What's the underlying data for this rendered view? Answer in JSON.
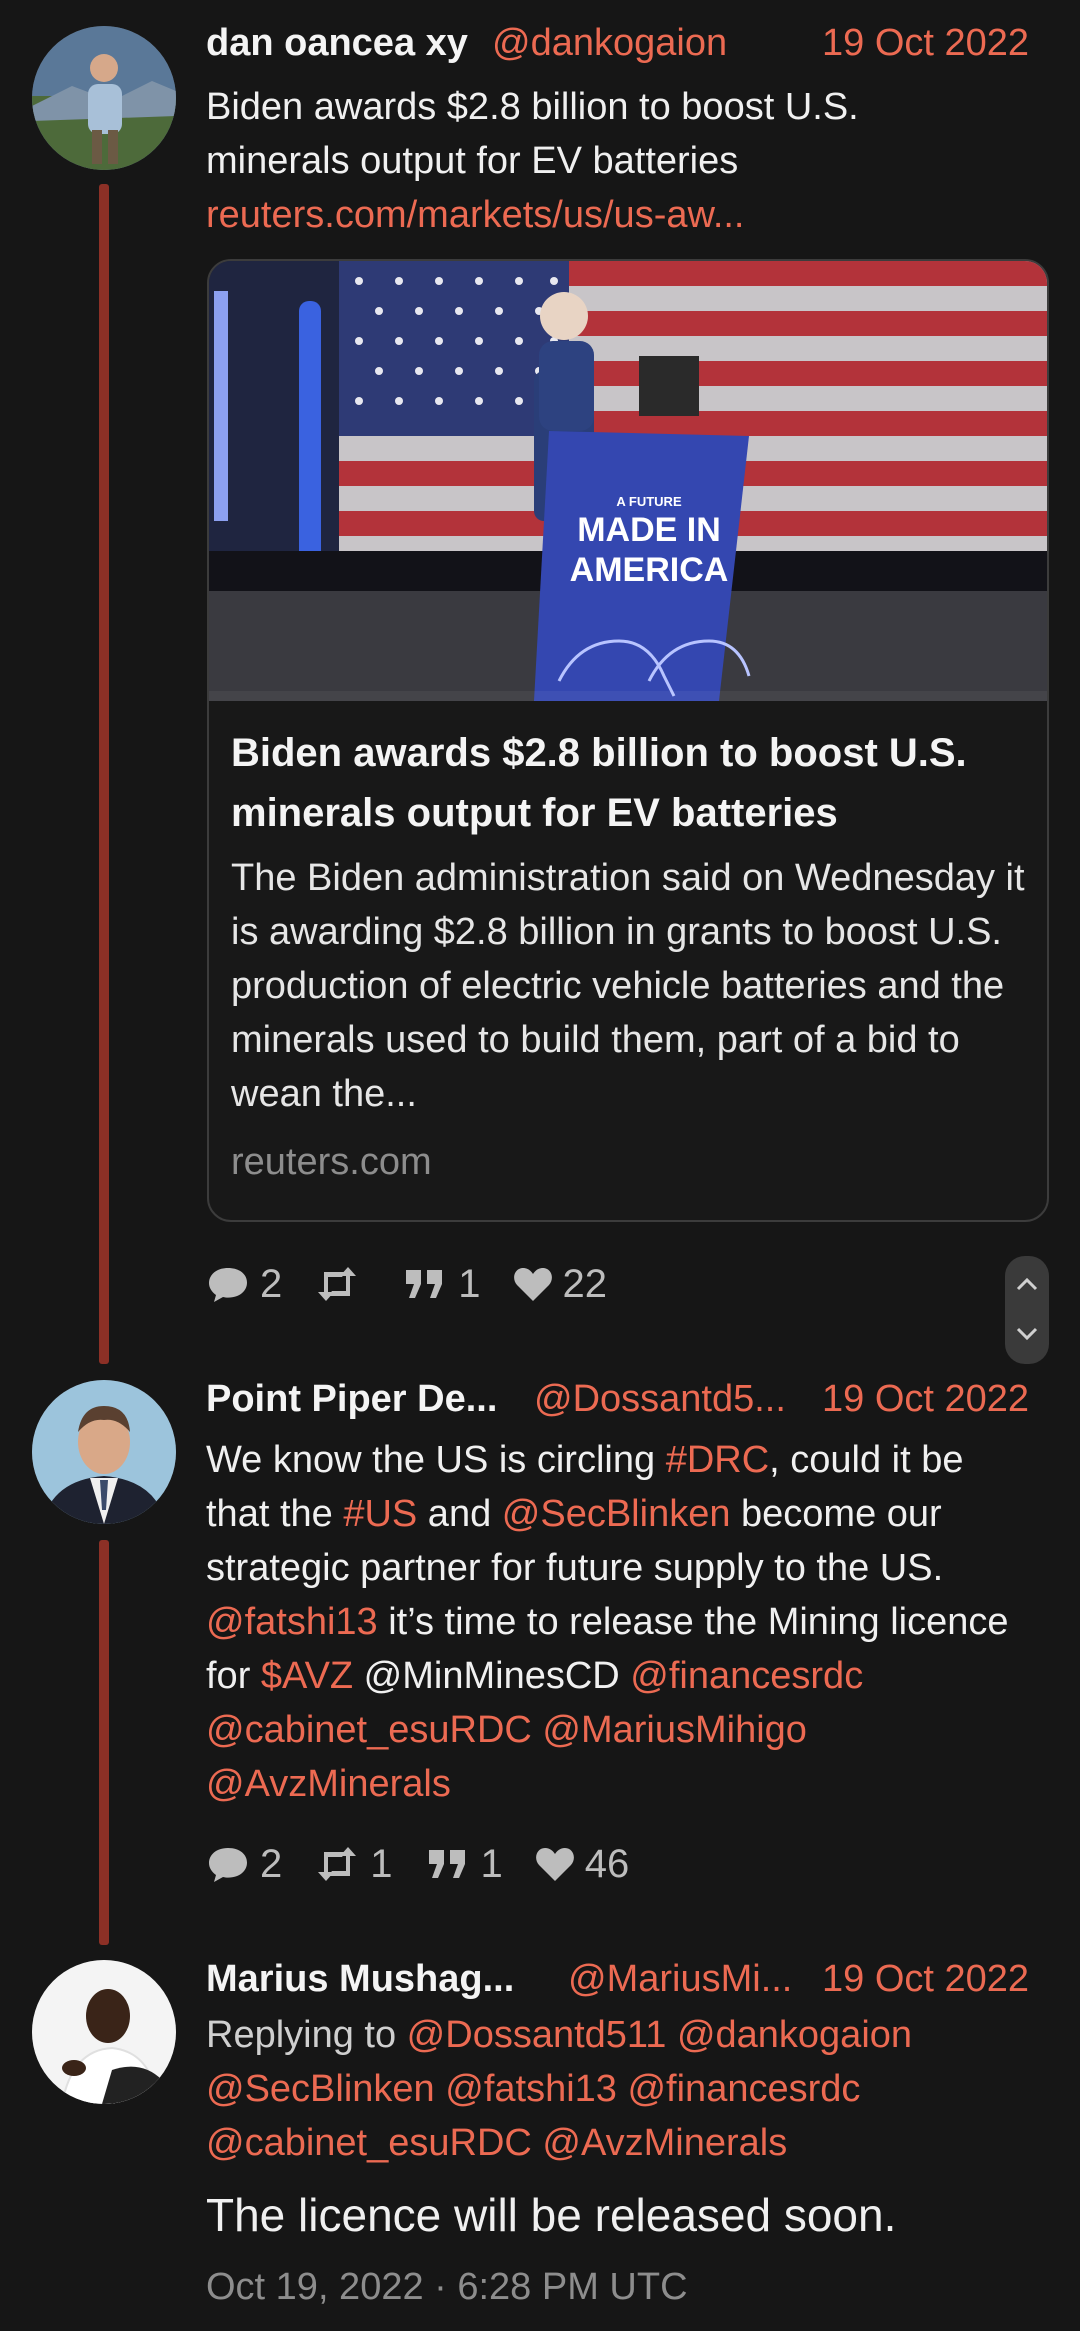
{
  "tweets": [
    {
      "name": "dan oancea xy",
      "handle": "@dankogaion",
      "date": "19 Oct 2022",
      "text": "Biden awards $2.8 billion to boost U.S. minerals output for EV batteries",
      "link": "reuters.com/markets/us/us-aw...",
      "card": {
        "image_sign_small": "A FUTURE",
        "image_sign_line1": "MADE IN",
        "image_sign_line2": "AMERICA",
        "title": "Biden awards $2.8 billion to boost U.S. minerals output for EV batteries",
        "description": "The Biden administration said on Wednesday it is awarding $2.8 billion in grants to boost U.S. production of electric vehicle batteries and the minerals used to build them, part of a bid to wean the...",
        "domain": "reuters.com"
      },
      "stats": {
        "replies": "2",
        "retweets": "",
        "quotes": "1",
        "likes": "22"
      }
    },
    {
      "name": "Point Piper De...",
      "handle": "@Dossantd5...",
      "date": "19 Oct 2022",
      "segments": [
        {
          "t": "We know the US is circling ",
          "link": false
        },
        {
          "t": "#DRC",
          "link": true
        },
        {
          "t": ", could it be that the ",
          "link": false
        },
        {
          "t": "#US",
          "link": true
        },
        {
          "t": " and ",
          "link": false
        },
        {
          "t": "@SecBlinken",
          "link": true
        },
        {
          "t": " become our strategic partner for future supply to the US. ",
          "link": false
        },
        {
          "t": "@fatshi13",
          "link": true
        },
        {
          "t": " it’s time to release the Mining licence for ",
          "link": false
        },
        {
          "t": "$AVZ",
          "link": true
        },
        {
          "t": " @MinMinesCD ",
          "link": false
        },
        {
          "t": "@financesrdc",
          "link": true
        },
        {
          "t": " ",
          "link": false
        },
        {
          "t": "@cabinet_esuRDC",
          "link": true
        },
        {
          "t": " ",
          "link": false
        },
        {
          "t": "@MariusMihigo",
          "link": true
        },
        {
          "t": " ",
          "link": false
        },
        {
          "t": "@AvzMinerals",
          "link": true
        }
      ],
      "stats": {
        "replies": "2",
        "retweets": "1",
        "quotes": "1",
        "likes": "46"
      }
    },
    {
      "name": "Marius Mushag...",
      "handle": "@MariusMi...",
      "date": "19 Oct 2022",
      "replying_prefix": "Replying to ",
      "replying_to": [
        "@Dossantd511",
        "@dankogaion",
        "@SecBlinken",
        "@fatshi13",
        "@financesrdc",
        "@cabinet_esuRDC",
        "@AvzMinerals"
      ],
      "text": "The licence will be released soon.",
      "timestamp": "Oct 19, 2022 · 6:28 PM UTC"
    }
  ],
  "colors": {
    "accent": "#ec6a52",
    "thread_line": "#8c3026",
    "background": "#161616"
  },
  "icons": [
    "comment-icon",
    "retweet-icon",
    "quote-icon",
    "heart-icon",
    "chevron-up-icon",
    "chevron-down-icon"
  ]
}
